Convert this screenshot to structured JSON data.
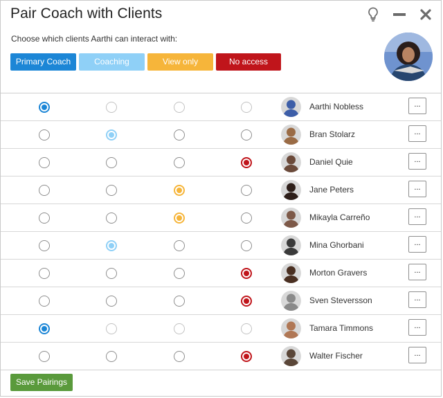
{
  "title": "Pair Coach with Clients",
  "subtitle": "Choose which clients Aarthi can interact with:",
  "legend": [
    {
      "label": "Primary Coach",
      "color": "#1c86d6"
    },
    {
      "label": "Coaching",
      "color": "#8fd0f7"
    },
    {
      "label": "View only",
      "color": "#f6b53a"
    },
    {
      "label": "No access",
      "color": "#c0151b"
    }
  ],
  "more_label": "...",
  "save_label": "Save Pairings",
  "clients": [
    {
      "name": "Aarthi Nobless",
      "selected": 0,
      "avatar_bg": "#3d5ea8"
    },
    {
      "name": "Bran Stolarz",
      "selected": 1,
      "avatar_bg": "#9a6b45"
    },
    {
      "name": "Daniel Quie",
      "selected": 3,
      "avatar_bg": "#6b4a3a"
    },
    {
      "name": "Jane Peters",
      "selected": 2,
      "avatar_bg": "#2e1f1a"
    },
    {
      "name": "Mikayla Carreño",
      "selected": 2,
      "avatar_bg": "#7d5948"
    },
    {
      "name": "Mina Ghorbani",
      "selected": 1,
      "avatar_bg": "#3a3a3a"
    },
    {
      "name": "Morton Gravers",
      "selected": 3,
      "avatar_bg": "#4a3022"
    },
    {
      "name": "Sven Steversson",
      "selected": 3,
      "avatar_bg": "#8a8a8a"
    },
    {
      "name": "Tamara Timmons",
      "selected": 0,
      "avatar_bg": "#b07755"
    },
    {
      "name": "Walter Fischer",
      "selected": 3,
      "avatar_bg": "#5a4638"
    }
  ]
}
